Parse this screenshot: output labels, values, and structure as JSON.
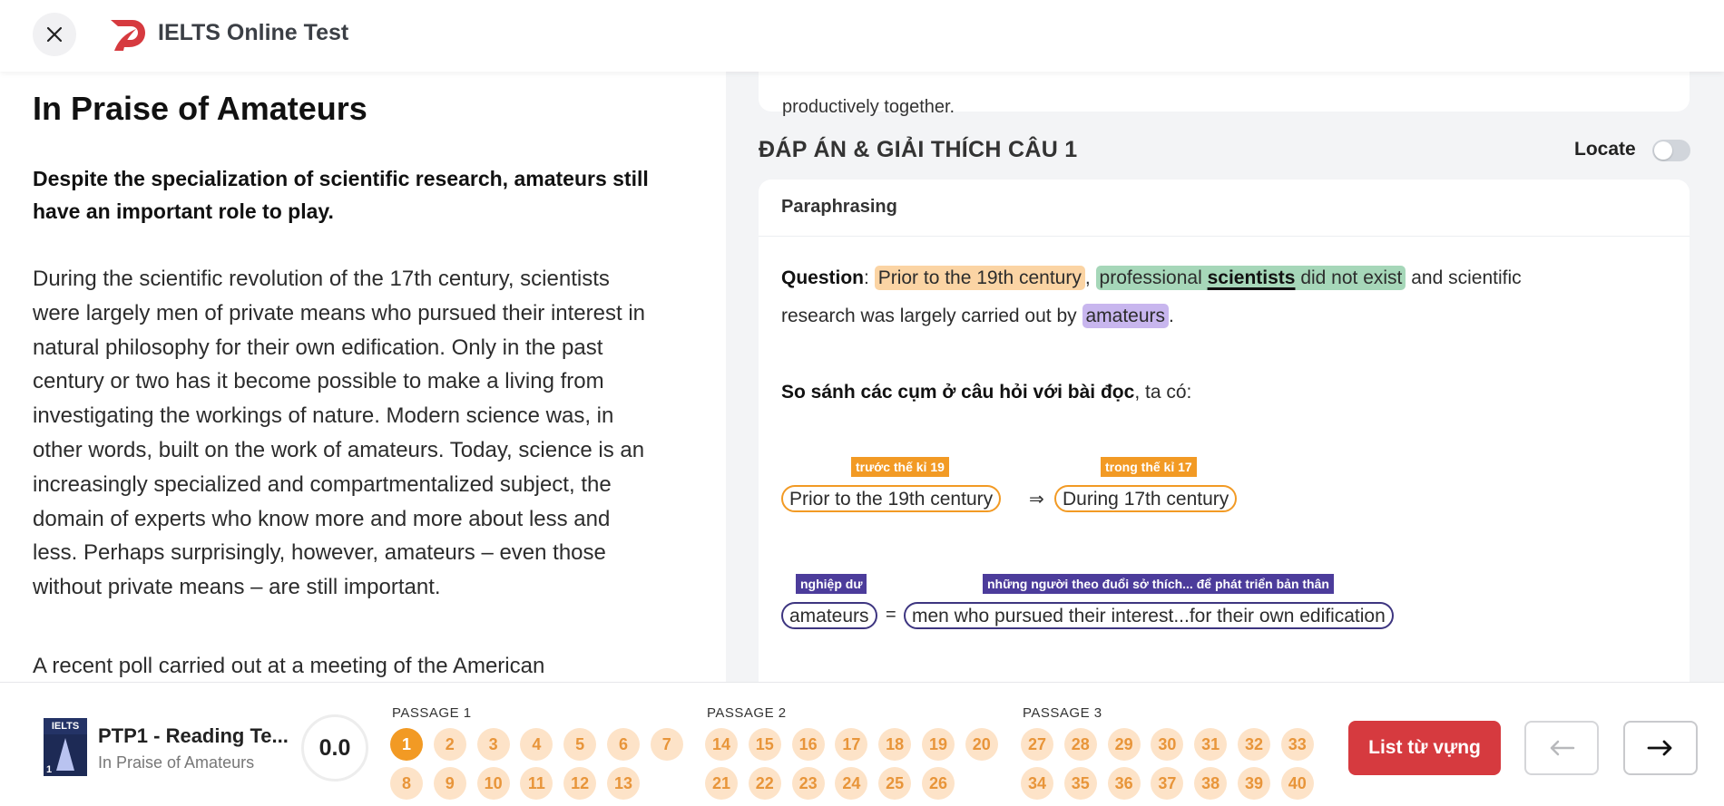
{
  "header": {
    "title": "IELTS Online Test"
  },
  "passage": {
    "title": "In Praise of Amateurs",
    "subtitle": "Despite the specialization of scientific research, amateurs still have an important role to play.",
    "para1_lines": [
      "During the scientific revolution of the 17th century, scientists",
      "were largely men of private means who pursued their interest in",
      "natural philosophy for their own edification. Only in the past",
      "century or two has it become possible to make a living from",
      "investigating the workings of nature. Modern science was, in",
      "other words, built on the work of amateurs. Today, science is an",
      "increasingly specialized and compartmentalized subject, the",
      "domain of experts who know more and more about less and",
      "less. Perhaps surprisingly, however, amateurs – even those",
      "without private means – are still important."
    ],
    "para2": "A recent poll carried out at a meeting of the American"
  },
  "answer": {
    "prev_text": "productively together.",
    "section_title": "ĐÁP ÁN & GIẢI THÍCH CÂU 1",
    "locate_label": "Locate",
    "card_heading": "Paraphrasing",
    "question_label": "Question",
    "q_colon": ":",
    "q_hl1": "Prior to the 19th century",
    "q_comma": ",",
    "q_hl2_pre": "professional",
    "q_hl2_bold": "scientists",
    "q_hl2_post": "did not exist",
    "q_rest1": "and scientific",
    "q_rest2": "research was largely carried out by",
    "q_hl3": "amateurs",
    "q_end": ".",
    "compare_bold": "So sánh các cụm ở câu hỏi với bài đọc",
    "compare_rest": ", ta có:",
    "pair1": {
      "tag_left": "trước thế kỉ 19",
      "tag_right": "trong thế kỉ 17",
      "left": "Prior to the 19th century",
      "symbol": "⇒",
      "right": "During 17th century"
    },
    "pair2": {
      "tag_left": "nghiệp dư",
      "tag_right": "những người theo đuổi sở thích... để phát triển bản thân",
      "left": "amateurs",
      "symbol": "=",
      "right": "men who pursued their interest...for their own edification"
    }
  },
  "footer": {
    "thumb_label": "IELTS",
    "thumb_num": "1",
    "test_title": "PTP1 - Reading Te...",
    "test_sub": "In Praise of Amateurs",
    "score": "0.0",
    "passage_labels": [
      "PASSAGE 1",
      "PASSAGE 2",
      "PASSAGE 3"
    ],
    "q": [
      "1",
      "2",
      "3",
      "4",
      "5",
      "6",
      "7",
      "8",
      "9",
      "10",
      "11",
      "12",
      "13",
      "14",
      "15",
      "16",
      "17",
      "18",
      "19",
      "20",
      "21",
      "22",
      "23",
      "24",
      "25",
      "26",
      "27",
      "28",
      "29",
      "30",
      "31",
      "32",
      "33",
      "34",
      "35",
      "36",
      "37",
      "38",
      "39",
      "40"
    ],
    "vocab_button": "List từ vựng",
    "prev_arrow": "←",
    "next_arrow": "→"
  },
  "colors": {
    "accent": "#f29a24",
    "primary_red": "#d63a3f",
    "purple": "#3d3580"
  }
}
